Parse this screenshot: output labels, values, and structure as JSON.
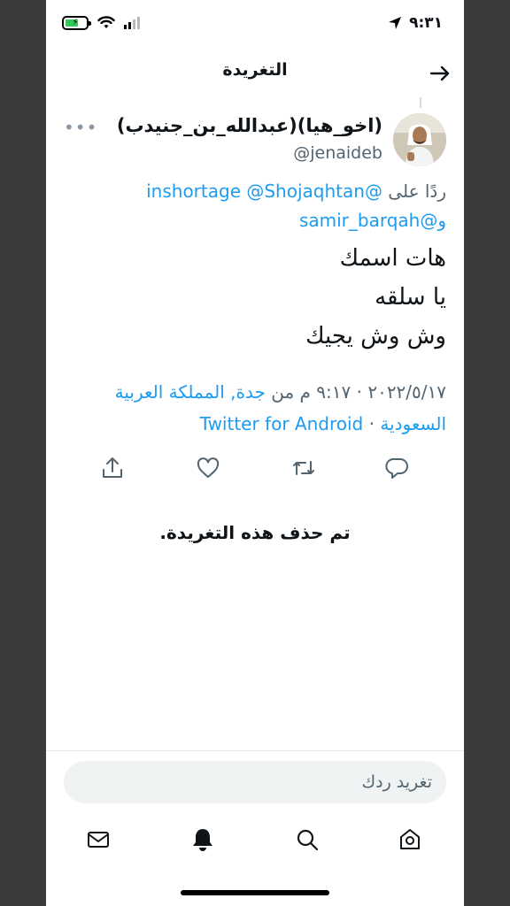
{
  "status_bar": {
    "time": "٩:٣١",
    "battery_icon": "battery-charging-icon",
    "wifi_icon": "wifi-icon",
    "signal_icon": "signal-icon",
    "location_icon": "location-arrow-icon"
  },
  "header": {
    "title": "التغريدة",
    "back_icon": "arrow-right-icon"
  },
  "tweet": {
    "display_name": "(اخو_هيا)(عبدالله_بن_جنيدب)",
    "handle": "@jenaideb",
    "reply_prefix": "ردًا على",
    "mentions": [
      "@Shojaqhtan",
      "@inshortage",
      "@samir_barqah"
    ],
    "mention_joiner": "و",
    "text_lines": [
      "هات اسمك",
      "يا سلقه",
      "وش وش يجيك"
    ],
    "date_time": "٢٠٢٢/٥/١٧ · ٩:١٧ م من",
    "location_line1": "جدة, المملكة العربية",
    "location_line2": "السعودية",
    "separator": "·",
    "source": "Twitter for Android"
  },
  "actions": {
    "reply_icon": "reply-icon",
    "retweet_icon": "retweet-icon",
    "like_icon": "heart-icon",
    "share_icon": "share-icon"
  },
  "deleted_notice": "تم حذف هذه التغريدة.",
  "reply_box": {
    "placeholder": "تغريد ردك"
  },
  "tab_bar": {
    "items": [
      "home-icon",
      "search-icon",
      "notifications-bell-icon",
      "messages-mail-icon"
    ]
  },
  "colors": {
    "accent": "#1d9bf0",
    "text": "#0f1419",
    "muted": "#536471",
    "battery": "#34c759"
  }
}
